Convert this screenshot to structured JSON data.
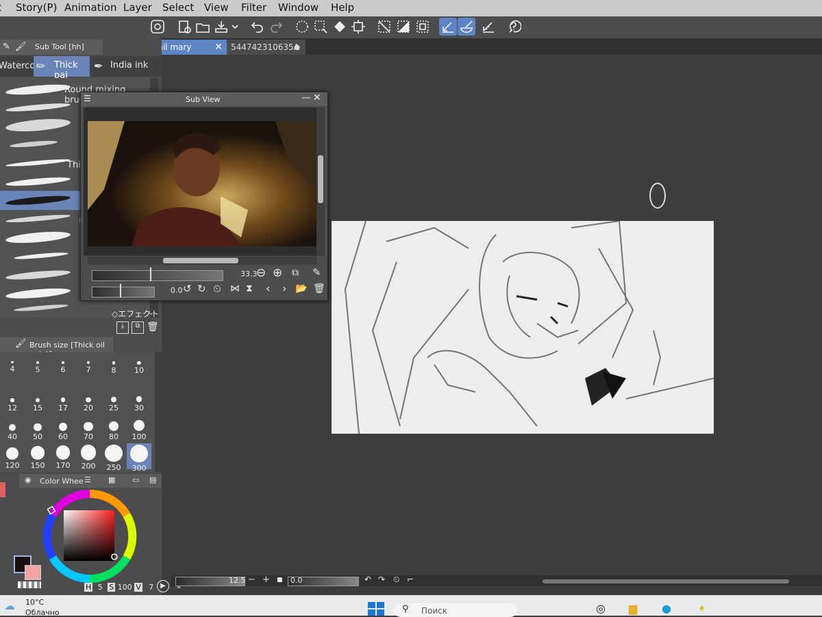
{
  "menu": {
    "items": [
      "Story(P)",
      "Animation",
      "Layer",
      "Select",
      "View",
      "Filter",
      "Window",
      "Help"
    ]
  },
  "toolbar": {
    "icons": [
      "clip-studio-icon",
      "new-file-icon",
      "open-folder-icon",
      "save-icon",
      "dropdown-arrow-icon",
      "undo-icon",
      "redo-icon",
      "select-all-icon",
      "deselect-icon",
      "fill-icon",
      "transform-icon",
      "crop-icon",
      "snap-off-icon",
      "snap-grid-icon",
      "snap-ruler-icon",
      "pen-active-icon",
      "brush-active-icon",
      "ruler-active-icon",
      "help-icon"
    ]
  },
  "tabs": [
    {
      "label": "hail mary",
      "active": true
    },
    {
      "label": "544742310635А",
      "active": false
    }
  ],
  "sub_tool": {
    "title": "Sub Tool [hh]",
    "group_tabs": [
      "Watercol",
      "Thick pai",
      "India ink"
    ],
    "active_group": "Thick pai",
    "brushes": [
      {
        "label": "Round mixing brush"
      },
      {
        "label": ""
      },
      {
        "label": ""
      },
      {
        "label": ""
      },
      {
        "label": "Thi"
      },
      {
        "label": ""
      },
      {
        "label": ""
      },
      {
        "label": "("
      },
      {
        "label": ""
      },
      {
        "label": ""
      },
      {
        "label": ""
      },
      {
        "label": ""
      }
    ],
    "selected_index": 6,
    "effect_label": "◇エフェクト"
  },
  "sub_view": {
    "title": "Sub View",
    "zoom": "33.3",
    "rotation": "0.0"
  },
  "brush_size": {
    "title": "Brush size [Thick oil paint]",
    "sizes": [
      "4",
      "5",
      "6",
      "7",
      "8",
      "10",
      "12",
      "15",
      "17",
      "20",
      "25",
      "30",
      "40",
      "50",
      "60",
      "70",
      "80",
      "100",
      "120",
      "150",
      "170",
      "200",
      "250",
      "300"
    ],
    "selected": "300"
  },
  "color_wheel": {
    "tab_label": "Color Whee",
    "h_label": "H",
    "h_value": "5",
    "s_label": "S",
    "s_value": "100",
    "v_label": "V",
    "v_value": "7",
    "main_color": "#1a1010",
    "sub_color": "#f0a3a3"
  },
  "status": {
    "zoom": "12.5",
    "rotation": "0.0"
  },
  "taskbar": {
    "temperature": "10°C",
    "weather": "Облачно",
    "search": "Поиск"
  },
  "colors": {
    "accent": "#5d84c4",
    "panel": "#4a4c4e",
    "workspace": "#3b3d3f"
  }
}
